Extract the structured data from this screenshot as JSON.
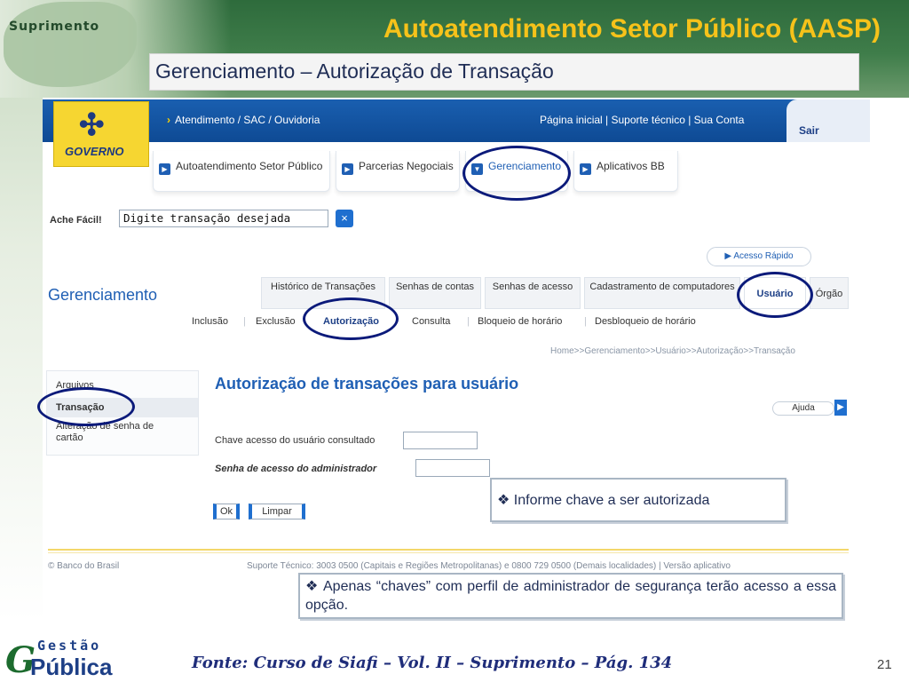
{
  "slide": {
    "title": "Autoatendimento Setor Público (AASP)",
    "subtitle": "Gerenciamento – Autorização de Transação",
    "corner_label": "Suprimento",
    "source": "Fonte: Curso de Siafi – Vol. II – Suprimento – Pág. 134",
    "page_number": "21",
    "logo": {
      "top": "Gestão",
      "bottom": "Pública"
    }
  },
  "bb": {
    "logo_text": "GOVERNO",
    "topbar": {
      "atendimento": "Atendimento / SAC / Ouvidoria",
      "right_links": "Página inicial  |  Suporte técnico  |  Sua Conta",
      "sair": "Sair"
    },
    "tabs": [
      {
        "label": "Autoatendimento Setor Público"
      },
      {
        "label": "Parcerias Negociais"
      },
      {
        "label": "Gerenciamento"
      },
      {
        "label": "Aplicativos BB"
      }
    ],
    "search": {
      "label": "Ache Fácil!",
      "value": "Digite transação desejada"
    },
    "acesso_rapido": "Acesso Rápido",
    "section_title": "Gerenciamento",
    "sub_tabs": [
      {
        "label": "Histórico de Transações"
      },
      {
        "label": "Senhas de contas"
      },
      {
        "label": "Senhas de acesso"
      },
      {
        "label": "Cadastramento de computadores"
      },
      {
        "label": "Usuário"
      },
      {
        "label": "Órgão"
      }
    ],
    "subnav": [
      "Inclusão",
      "Exclusão",
      "Autorização",
      "Consulta",
      "Bloqueio de horário",
      "Desbloqueio de horário"
    ],
    "breadcrumb": "Home>>Gerenciamento>>Usuário>>Autorização>>Transação",
    "sidebar": [
      "Arquivos",
      "Transação",
      "Alteração de senha de cartão"
    ],
    "page_heading": "Autorização de transações para usuário",
    "help_button": "Ajuda",
    "fields": {
      "user_key": "Chave acesso do usuário consultado",
      "admin_password": "Senha de acesso do administrador"
    },
    "buttons": {
      "ok": "Ok",
      "clear": "Limpar"
    },
    "footer": {
      "copyright": "© Banco do Brasil",
      "support": "Suporte Técnico: 3003 0500 (Capitais e Regiões Metropolitanas) e 0800 729 0500 (Demais localidades)  |  Versão aplicativo"
    }
  },
  "annotations": {
    "note1": "Informe chave a ser autorizada",
    "note2": "Apenas “chaves” com perfil de administrador de  segurança terão  acesso a essa opção.",
    "bullet": "❖"
  }
}
